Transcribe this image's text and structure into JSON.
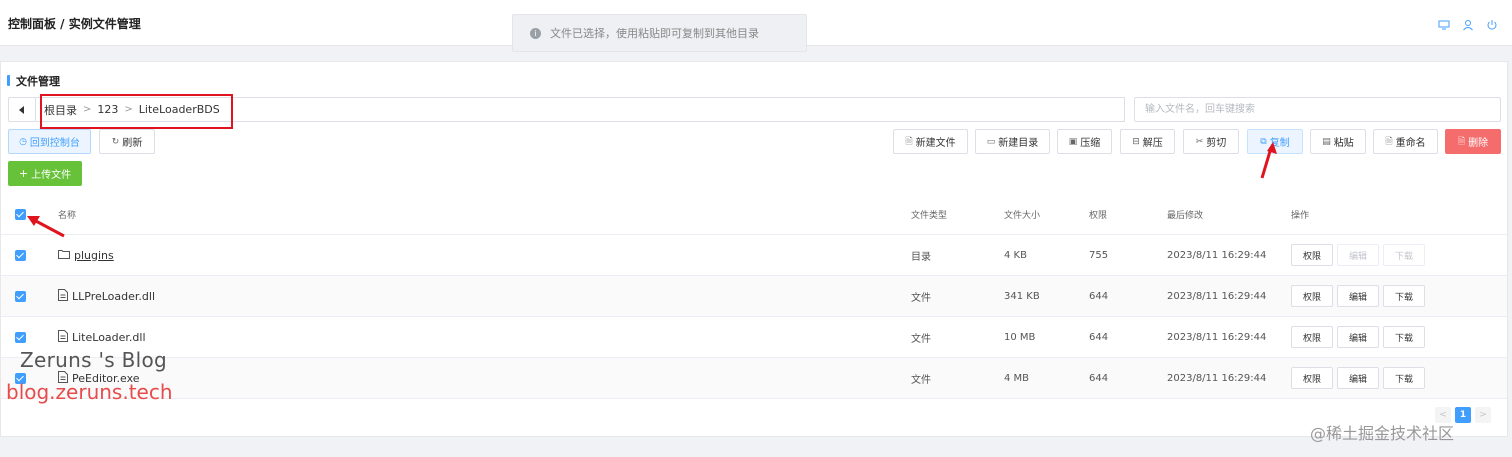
{
  "header": {
    "title": "控制面板 / 实例文件管理",
    "toast": "文件已选择，使用粘贴即可复制到其他目录",
    "icons": [
      "desktop-icon",
      "user-icon",
      "power-icon"
    ]
  },
  "panel": {
    "title": "文件管理",
    "breadcrumb": [
      "根目录",
      "123",
      "LiteLoaderBDS"
    ],
    "search_placeholder": "输入文件名，回车键搜索",
    "buttons_left": [
      "回到控制台",
      "刷新"
    ],
    "buttons_right": [
      "新建文件",
      "新建目录",
      "压缩",
      "解压",
      "剪切",
      "复制",
      "粘贴",
      "重命名",
      "删除"
    ],
    "upload": "上传文件"
  },
  "table": {
    "headers": [
      "名称",
      "文件类型",
      "文件大小",
      "权限",
      "最后修改",
      "操作"
    ],
    "rows": [
      {
        "name": "plugins",
        "type": "目录",
        "size": "4 KB",
        "perm": "755",
        "modified": "2023/8/11 16:29:44",
        "is_dir": true
      },
      {
        "name": "LLPreLoader.dll",
        "type": "文件",
        "size": "341 KB",
        "perm": "644",
        "modified": "2023/8/11 16:29:44",
        "is_dir": false
      },
      {
        "name": "LiteLoader.dll",
        "type": "文件",
        "size": "10 MB",
        "perm": "644",
        "modified": "2023/8/11 16:29:44",
        "is_dir": false
      },
      {
        "name": "PeEditor.exe",
        "type": "文件",
        "size": "4 MB",
        "perm": "644",
        "modified": "2023/8/11 16:29:44",
        "is_dir": false
      }
    ],
    "actions": [
      "权限",
      "编辑",
      "下载"
    ]
  },
  "pagination": {
    "current": "1"
  },
  "watermarks": {
    "blog_name": "Zeruns 's Blog",
    "blog_url": "blog.zeruns.tech",
    "site": "@稀土掘金技术社区"
  },
  "colors": {
    "accent": "#409eff",
    "danger": "#f56c6c",
    "success": "#67c23a",
    "highlight": "#e0141e"
  }
}
